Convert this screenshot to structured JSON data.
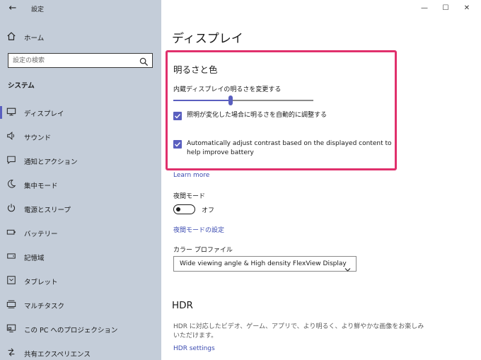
{
  "window": {
    "title": "設定",
    "back_glyph": "←",
    "minimize_glyph": "—",
    "maximize_glyph": "☐",
    "close_glyph": "✕"
  },
  "sidebar": {
    "home_label": "ホーム",
    "search_placeholder": "設定の検索",
    "section_title": "システム",
    "items": [
      {
        "label": "ディスプレイ",
        "icon": "monitor-icon",
        "active": true
      },
      {
        "label": "サウンド",
        "icon": "speaker-icon"
      },
      {
        "label": "通知とアクション",
        "icon": "message-icon"
      },
      {
        "label": "集中モード",
        "icon": "moon-icon"
      },
      {
        "label": "電源とスリープ",
        "icon": "power-icon"
      },
      {
        "label": "バッテリー",
        "icon": "battery-icon"
      },
      {
        "label": "記憶域",
        "icon": "storage-icon"
      },
      {
        "label": "タブレット",
        "icon": "tablet-icon"
      },
      {
        "label": "マルチタスク",
        "icon": "multitask-icon"
      },
      {
        "label": "この PC へのプロジェクション",
        "icon": "projection-icon"
      },
      {
        "label": "共有エクスペリエンス",
        "icon": "share-icon"
      }
    ]
  },
  "main": {
    "page_title": "ディスプレイ",
    "brightness_heading": "明るさと色",
    "slider_label": "内蔵ディスプレイの明るさを変更する",
    "brightness_value": 0.41,
    "check1_label": "照明が変化した場合に明るさを自動的に調整する",
    "check2_line1": "Automatically adjust contrast based on the displayed content to",
    "check2_line2": "help improve battery",
    "learn_more": "Learn more",
    "night_label": "夜間モード",
    "night_state": "オフ",
    "night_settings_link": "夜間モードの設定",
    "color_profile_label": "カラー プロファイル",
    "color_profile_value": "Wide viewing angle & High density FlexView Display",
    "hdr_heading": "HDR",
    "hdr_line1": "HDR に対応したビデオ、ゲーム、アプリで、より明るく、より鮮やかな画像をお楽しみ",
    "hdr_line2": "いただけます。",
    "hdr_settings_link": "HDR settings"
  },
  "colors": {
    "accent": "#5a5fbf",
    "highlight": "#e0306c",
    "sidebar_bg": "#c4cdd9",
    "link": "#3a4ab0"
  }
}
